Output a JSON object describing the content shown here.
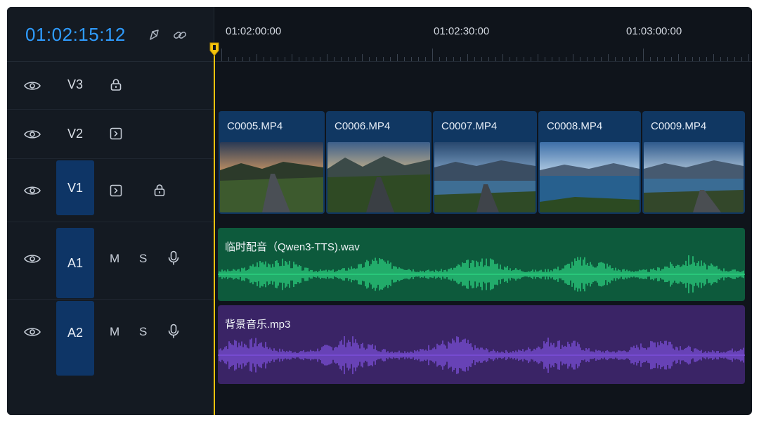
{
  "timeline": {
    "timecode": "01:02:15:12",
    "ruler_labels": [
      "01:02:00:00",
      "01:02:30:00",
      "01:03:00:00"
    ]
  },
  "tracks": {
    "v3": {
      "label": "V3"
    },
    "v2": {
      "label": "V2"
    },
    "v1": {
      "label": "V1"
    },
    "a1": {
      "label": "A1",
      "mute": "M",
      "solo": "S"
    },
    "a2": {
      "label": "A2",
      "mute": "M",
      "solo": "S"
    }
  },
  "video_clips": [
    {
      "name": "C0005.MP4"
    },
    {
      "name": "C0006.MP4"
    },
    {
      "name": "C0007.MP4"
    },
    {
      "name": "C0008.MP4"
    },
    {
      "name": "C0009.MP4"
    }
  ],
  "audio_clips": [
    {
      "name": "临时配音（Qwen3-TTS).wav",
      "color": "#0d5a3c",
      "wave_color": "#2bd07f"
    },
    {
      "name": "背景音乐.mp3",
      "color": "#3a2466",
      "wave_color": "#7b4fd9"
    }
  ],
  "colors": {
    "accent": "#2f9cff",
    "playhead": "#f3c20c",
    "selected_track": "#0e3566",
    "video_clip": "#103762"
  }
}
